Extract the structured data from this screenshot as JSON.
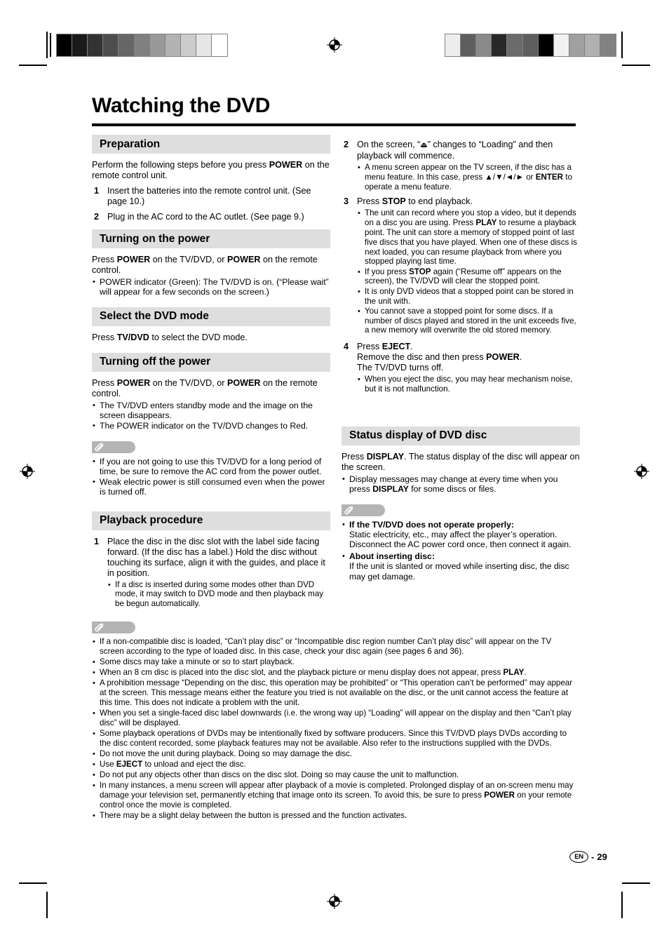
{
  "page": {
    "title": "Watching the DVD",
    "footer_locale": "EN",
    "footer_separator": "-",
    "footer_page_number": "29",
    "accent_band_color": "#dedede",
    "note_tab_color": "#b4b4b4"
  },
  "print_marks": {
    "left_wedge_swatches": [
      "#000000",
      "#1a1a1a",
      "#333333",
      "#4d4d4d",
      "#666666",
      "#808080",
      "#999999",
      "#b3b3b3",
      "#cccccc",
      "#e6e6e6",
      "#ffffff"
    ],
    "right_wedge_swatches": [
      "#ededed",
      "#5e5e5e",
      "#8a8a8a",
      "#282828",
      "#6b6b6b",
      "#5e5e5e",
      "#000000",
      "#f2f2f2",
      "#a0a0a0",
      "#b0b0b0",
      "#828282"
    ],
    "registration_icon": "registration-target-icon"
  },
  "left_column": {
    "preparation": {
      "heading": "Preparation",
      "intro_html": "Perform the following steps before you press <b>POWER</b> on the remote control unit.",
      "steps": [
        {
          "num": "1",
          "text": "Insert the batteries into the remote control unit. (See page 10.)"
        },
        {
          "num": "2",
          "text": "Plug in the AC cord to the AC outlet. (See page 9.)"
        }
      ]
    },
    "turning_on": {
      "heading": "Turning on the power",
      "intro_html": "Press <b>POWER</b> on the TV/DVD, or <b>POWER</b> on the remote control.",
      "bullets": [
        "POWER indicator (Green): The TV/DVD is on. (“Please wait” will appear for a few seconds on the screen.)"
      ]
    },
    "select_mode": {
      "heading": "Select the DVD mode",
      "intro_html": "Press <b>TV/DVD</b> to select the DVD mode."
    },
    "turning_off": {
      "heading": "Turning off the power",
      "intro_html": "Press <b>POWER</b> on the TV/DVD, or <b>POWER</b> on the remote control.",
      "bullets": [
        "The TV/DVD enters standby mode and the image on the screen disappears.",
        "The POWER indicator on the TV/DVD changes to Red."
      ]
    },
    "note_block": {
      "icon": "paperclip-icon",
      "bullets": [
        "If you are not going to use this TV/DVD for a long period of time, be sure to remove the AC cord from the power outlet.",
        "Weak electric power is still consumed even when the power is turned off."
      ]
    },
    "playback": {
      "heading": "Playback procedure",
      "step_num": "1",
      "step_text": "Place the disc in the disc slot with the label side facing forward. (If the disc has a label.) Hold the disc without touching its surface, align it with the guides, and place it in position.",
      "sub_bullets": [
        "If a disc is inserted during some modes other than DVD mode, it may switch to DVD mode and then playback may be begun automatically."
      ]
    }
  },
  "right_column": {
    "step2": {
      "num": "2",
      "text_html": "On the screen, “<span class=\"eject\">⏏</span>” changes to “Loading” and then playback will commence.",
      "bullets_html": [
        "A menu screen appear on the TV screen, if the disc has a menu feature. In this case, press ▲/▼/◄/► or <b>ENTER</b> to operate a menu feature."
      ]
    },
    "step3": {
      "num": "3",
      "text_html": "Press <b>STOP</b> to end playback.",
      "bullets_html": [
        "The unit can record where you stop a video, but it depends on a disc you are using. Press <b>PLAY</b> to resume a playback point. The unit can store a memory of stopped point of last five discs that you have played. When one of these discs is next loaded, you can resume playback from where you stopped playing last time.",
        "If you press <b>STOP</b> again (“Resume off” appears on the screen), the TV/DVD will clear the stopped point.",
        "It is only DVD videos that a stopped point can be stored in the unit with.",
        "You cannot save a stopped point for some discs. If a number of discs played and stored in the unit exceeds five, a new memory will overwrite the old stored memory."
      ]
    },
    "step4": {
      "num": "4",
      "text_html": "Press <b>EJECT</b>.<br>Remove the disc and then press <b>POWER</b>.<br>The TV/DVD turns off.",
      "bullets_html": [
        "When you eject the disc, you may hear mechanism noise, but it is not malfunction."
      ]
    },
    "status_display": {
      "heading": "Status display of DVD disc",
      "intro_html": "Press <b>DISPLAY</b>. The status display of the disc will appear on the screen.",
      "bullets_html": [
        "Display messages may change at every time when you press <b>DISPLAY</b> for some discs or files."
      ]
    },
    "note_block": {
      "icon": "paperclip-icon",
      "bullets_html": [
        "<b>If the TV/DVD does not operate properly:</b><br>Static electricity, etc., may affect the player’s operation. Disconnect the AC power cord once, then connect it again.",
        "<b>About inserting disc:</b><br>If the unit is slanted or moved while inserting disc, the disc may get damage."
      ]
    }
  },
  "bottom_notes": {
    "icon": "paperclip-icon",
    "bullets_html": [
      "If a non-compatible disc is loaded, “Can’t play disc” or “Incompatible disc region number Can’t play disc” will appear on the TV screen according to the type of loaded disc. In this case, check your disc again (see pages 6 and 36).",
      "Some discs may take a minute or so to start playback.",
      "When an 8 cm disc is placed into the disc slot, and the playback picture or menu display does not appear, press <b>PLAY</b>.",
      "A prohibition message “Depending on the disc, this operation may be prohibited” or “This operation can’t be performed” may appear at the screen. This message means either the feature you tried is not available on the disc, or the unit cannot access the feature at this time. This does not indicate a problem with the unit.",
      "When you set a single-faced disc label downwards (i.e. the wrong way up) “Loading” will appear on the display and then “Can’t play disc” will be displayed.",
      "Some playback operations of DVDs may be intentionally fixed by software producers. Since this TV/DVD plays DVDs according to the disc content recorded, some playback features may not be available. Also refer to the instructions supplied with the DVDs.",
      "Do not move the unit during playback. Doing so may damage the disc.",
      "Use <b>EJECT</b> to unload and eject the disc.",
      "Do not put any objects other than discs on the disc slot. Doing so may cause the unit to malfunction.",
      "In many instances, a menu screen will appear after playback of a movie is completed. Prolonged display of an on-screen menu may damage your television set, permanently etching that image onto its screen. To avoid this, be sure to press <b>POWER</b> on your remote control once the movie is completed.",
      "There may be a slight delay between the button is pressed and the function activates."
    ]
  }
}
